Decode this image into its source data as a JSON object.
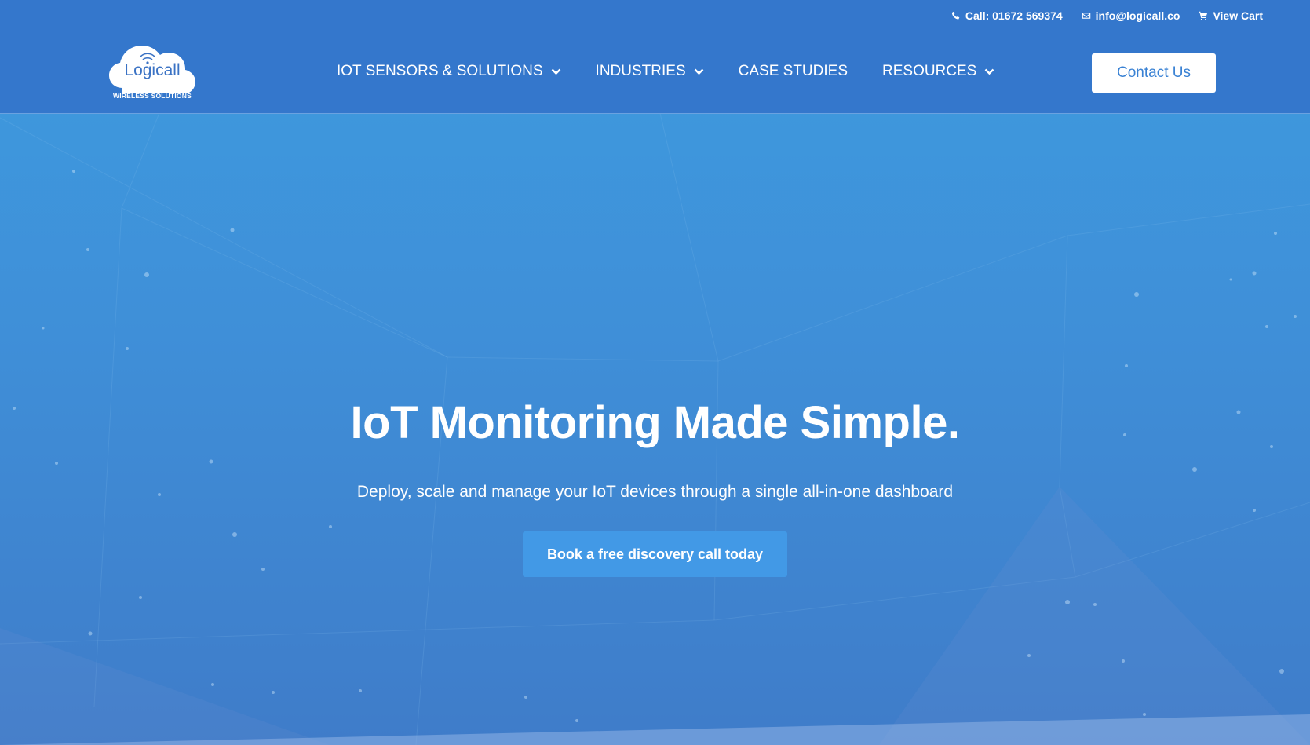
{
  "topbar": {
    "call_label": "Call: 01672 569374",
    "email_label": "info@logicall.co",
    "cart_label": "View Cart",
    "icons": [
      "phone-icon",
      "envelope-icon",
      "cart-icon"
    ]
  },
  "logo": {
    "name": "Logicall",
    "tagline": "WIRELESS SOLUTIONS"
  },
  "nav": {
    "items": [
      {
        "label": "IOT SENSORS & SOLUTIONS",
        "has_dropdown": true
      },
      {
        "label": "INDUSTRIES",
        "has_dropdown": true
      },
      {
        "label": "CASE STUDIES",
        "has_dropdown": false
      },
      {
        "label": "RESOURCES",
        "has_dropdown": true
      }
    ]
  },
  "header": {
    "contact_label": "Contact Us"
  },
  "hero": {
    "title": "IoT Monitoring Made Simple.",
    "subtitle": "Deploy, scale and manage your IoT devices through a single all-in-one dashboard",
    "cta_label": "Book a free discovery call today"
  },
  "colors": {
    "header_bg": "#3477cc",
    "hero_top": "#3e9bdf",
    "hero_bottom": "#3f7cc9",
    "cta_bg": "#4299e6",
    "contact_text": "#3a82d4"
  }
}
